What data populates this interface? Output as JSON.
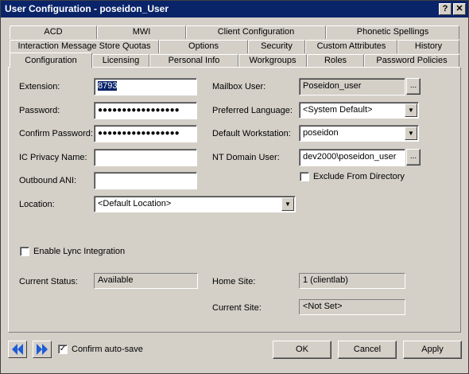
{
  "window": {
    "title": "User Configuration - poseidon_User",
    "help_glyph": "?",
    "close_glyph": "✕"
  },
  "tabs": {
    "row1": [
      "ACD",
      "MWI",
      "Client Configuration",
      "Phonetic Spellings"
    ],
    "row2": [
      "Interaction Message Store Quotas",
      "Options",
      "Security",
      "Custom Attributes",
      "History"
    ],
    "row3": [
      "Configuration",
      "Licensing",
      "Personal Info",
      "Workgroups",
      "Roles",
      "Password Policies"
    ],
    "active": "Configuration"
  },
  "form": {
    "extension_label": "Extension:",
    "extension_value": "8793",
    "password_label": "Password:",
    "password_value": "●●●●●●●●●●●●●●●●●",
    "confirm_password_label": "Confirm Password:",
    "confirm_password_value": "●●●●●●●●●●●●●●●●●",
    "privacy_label": "IC Privacy Name:",
    "privacy_value": "",
    "outbound_label": "Outbound ANI:",
    "outbound_value": "",
    "location_label": "Location:",
    "location_value": "<Default Location>",
    "mailbox_label": "Mailbox User:",
    "mailbox_value": "Poseidon_user",
    "language_label": "Preferred Language:",
    "language_value": "<System Default>",
    "workstation_label": "Default Workstation:",
    "workstation_value": "poseidon",
    "ntdomain_label": "NT Domain User:",
    "ntdomain_value": "dev2000\\poseidon_user",
    "exclude_label": "Exclude From Directory",
    "exclude_checked": false,
    "lync_label": "Enable Lync Integration",
    "lync_checked": false,
    "status_label": "Current Status:",
    "status_value": "Available",
    "home_site_label": "Home Site:",
    "home_site_value": "1 (clientlab)",
    "current_site_label": "Current Site:",
    "current_site_value": "<Not Set>",
    "ellipsis": "..."
  },
  "footer": {
    "autosave_label": "Confirm auto-save",
    "autosave_checked": true,
    "ok_label": "OK",
    "cancel_label": "Cancel",
    "apply_label": "Apply"
  },
  "colors": {
    "titlebar": "#0a246a",
    "face": "#d4d0c8",
    "selection": "#0a246a",
    "nav_arrow": "#1e5bd6"
  }
}
